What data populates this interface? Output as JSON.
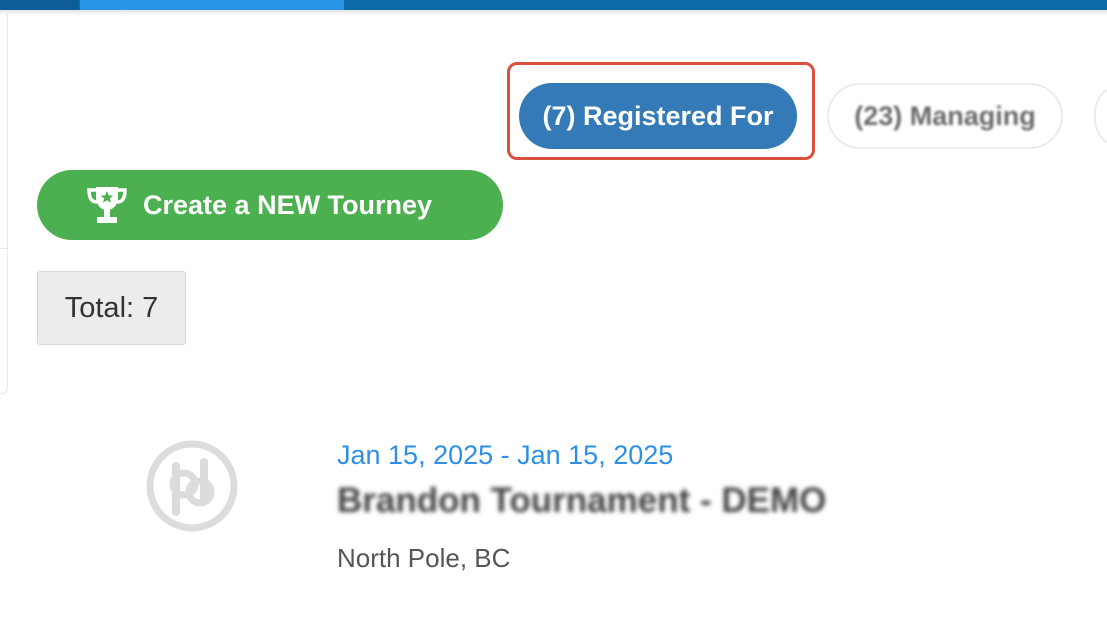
{
  "colors": {
    "nav_primary": "#0d6aa8",
    "nav_active": "#2a95e6",
    "filter_active": "#337ab7",
    "create_green": "#4caf50",
    "date_blue": "#2e8fe6",
    "highlight_red": "#d9503f"
  },
  "filters": {
    "registered_for": "(7) Registered For",
    "managing": "(23) Managing",
    "selected": "registered_for"
  },
  "actions": {
    "create_label": "Create a NEW Tourney",
    "create_icon": "trophy-star-icon"
  },
  "summary": {
    "total_label": "Total: 7"
  },
  "events": [
    {
      "logo_icon": "pb-logo-icon",
      "date_range": "Jan 15, 2025 - Jan 15, 2025",
      "name": "Brandon Tournament - DEMO",
      "location": "North Pole, BC"
    }
  ]
}
